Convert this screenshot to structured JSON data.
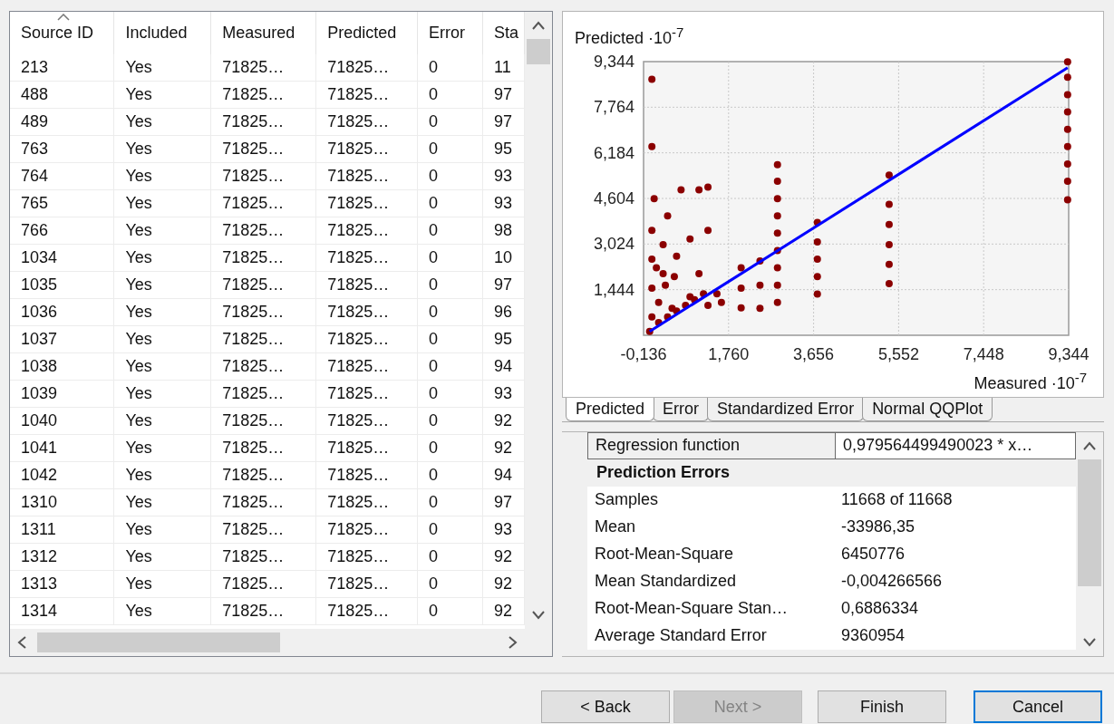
{
  "table": {
    "columns": [
      {
        "label": "Source ID",
        "sorted": true
      },
      {
        "label": "Included",
        "sorted": false
      },
      {
        "label": "Measured",
        "sorted": false
      },
      {
        "label": "Predicted",
        "sorted": false
      },
      {
        "label": "Error",
        "sorted": false
      },
      {
        "label": "Sta",
        "sorted": false
      }
    ],
    "rows": [
      [
        "213",
        "Yes",
        "71825…",
        "71825…",
        "0",
        "11"
      ],
      [
        "488",
        "Yes",
        "71825…",
        "71825…",
        "0",
        "97"
      ],
      [
        "489",
        "Yes",
        "71825…",
        "71825…",
        "0",
        "97"
      ],
      [
        "763",
        "Yes",
        "71825…",
        "71825…",
        "0",
        "95"
      ],
      [
        "764",
        "Yes",
        "71825…",
        "71825…",
        "0",
        "93"
      ],
      [
        "765",
        "Yes",
        "71825…",
        "71825…",
        "0",
        "93"
      ],
      [
        "766",
        "Yes",
        "71825…",
        "71825…",
        "0",
        "98"
      ],
      [
        "1034",
        "Yes",
        "71825…",
        "71825…",
        "0",
        "10"
      ],
      [
        "1035",
        "Yes",
        "71825…",
        "71825…",
        "0",
        "97"
      ],
      [
        "1036",
        "Yes",
        "71825…",
        "71825…",
        "0",
        "96"
      ],
      [
        "1037",
        "Yes",
        "71825…",
        "71825…",
        "0",
        "95"
      ],
      [
        "1038",
        "Yes",
        "71825…",
        "71825…",
        "0",
        "94"
      ],
      [
        "1039",
        "Yes",
        "71825…",
        "71825…",
        "0",
        "93"
      ],
      [
        "1040",
        "Yes",
        "71825…",
        "71825…",
        "0",
        "92"
      ],
      [
        "1041",
        "Yes",
        "71825…",
        "71825…",
        "0",
        "92"
      ],
      [
        "1042",
        "Yes",
        "71825…",
        "71825…",
        "0",
        "94"
      ],
      [
        "1310",
        "Yes",
        "71825…",
        "71825…",
        "0",
        "97"
      ],
      [
        "1311",
        "Yes",
        "71825…",
        "71825…",
        "0",
        "93"
      ],
      [
        "1312",
        "Yes",
        "71825…",
        "71825…",
        "0",
        "92"
      ],
      [
        "1313",
        "Yes",
        "71825…",
        "71825…",
        "0",
        "92"
      ],
      [
        "1314",
        "Yes",
        "71825…",
        "71825…",
        "0",
        "92"
      ]
    ]
  },
  "chart": {
    "chart_data": {
      "type": "scatter",
      "ylabel": "Predicted ·10$^{-7}$",
      "xlabel": "Measured ·10$^{-7}$",
      "grid": true,
      "xlim": [
        -0.136,
        9.344
      ],
      "ylim": [
        -0.136,
        9.344
      ],
      "xticks": [
        {
          "value": -0.136,
          "label": "-0,136"
        },
        {
          "value": 1.76,
          "label": "1,760"
        },
        {
          "value": 3.656,
          "label": "3,656"
        },
        {
          "value": 5.552,
          "label": "5,552"
        },
        {
          "value": 7.448,
          "label": "7,448"
        },
        {
          "value": 9.344,
          "label": "9,344"
        }
      ],
      "yticks": [
        {
          "value": 1.444,
          "label": "1,444"
        },
        {
          "value": 3.024,
          "label": "3,024"
        },
        {
          "value": 4.604,
          "label": "4,604"
        },
        {
          "value": 6.184,
          "label": "6,184"
        },
        {
          "value": 7.764,
          "label": "7,764"
        },
        {
          "value": 9.344,
          "label": "9,344"
        }
      ],
      "x": [
        0,
        0.05,
        0.05,
        0.05,
        0.05,
        0.1,
        0.05,
        0.05,
        0.2,
        0.3,
        0.3,
        0.4,
        0.5,
        0.6,
        0.7,
        0.9,
        0.9,
        1.1,
        1.1,
        1.3,
        1.3,
        1.3,
        1.5,
        1.6,
        0.2,
        0.4,
        0.6,
        0.8,
        1.0,
        1.2,
        0.15,
        0.35,
        0.55,
        2.04,
        2.04,
        2.04,
        2.46,
        2.46,
        2.46,
        2.85,
        2.85,
        2.85,
        2.85,
        2.85,
        2.85,
        2.85,
        2.85,
        2.85,
        3.74,
        3.74,
        3.74,
        3.74,
        3.74,
        5.34,
        5.34,
        5.34,
        5.34,
        5.34,
        5.34,
        9.32,
        9.32,
        9.32,
        9.32,
        9.32,
        9.32,
        9.32,
        9.32,
        9.32
      ],
      "series": [
        {
          "color": "#8b0000",
          "values": [
            0,
            0.5,
            1.5,
            2.5,
            3.5,
            4.6,
            8.73,
            6.4,
            1.0,
            2.0,
            3.0,
            4.0,
            0.8,
            2.6,
            4.9,
            3.2,
            1.2,
            4.9,
            2.0,
            5.0,
            3.5,
            0.9,
            1.3,
            1.0,
            0.3,
            0.5,
            0.7,
            0.9,
            1.1,
            1.3,
            2.2,
            1.6,
            1.9,
            0.81,
            1.5,
            2.2,
            0.8,
            1.6,
            2.44,
            1.0,
            1.6,
            2.2,
            2.8,
            3.4,
            4.0,
            4.6,
            5.2,
            5.77,
            1.29,
            1.9,
            2.5,
            3.1,
            3.77,
            1.65,
            2.32,
            3.0,
            3.7,
            4.4,
            5.41,
            4.56,
            5.2,
            5.8,
            6.4,
            7.0,
            7.6,
            8.2,
            8.8,
            9.34
          ]
        },
        {
          "type": "line",
          "color": "#0000ff",
          "values": [
            0,
            null,
            null,
            null,
            null,
            null,
            null,
            null,
            null,
            null,
            null,
            null,
            null,
            null,
            null,
            null,
            null,
            null,
            null,
            null,
            null,
            null,
            null,
            null,
            null,
            null,
            null,
            null,
            null,
            null,
            null,
            null,
            null,
            null,
            null,
            null,
            null,
            null,
            null,
            null,
            null,
            null,
            null,
            null,
            null,
            null,
            null,
            null,
            null,
            null,
            null,
            null,
            null,
            null,
            null,
            null,
            null,
            null,
            null,
            null,
            null,
            null,
            null,
            null,
            null,
            null,
            null,
            9.13
          ]
        }
      ]
    }
  },
  "tabs": [
    {
      "label": "Predicted",
      "selected": true
    },
    {
      "label": "Error",
      "selected": false
    },
    {
      "label": "Standardized Error",
      "selected": false
    },
    {
      "label": "Normal QQPlot",
      "selected": false
    }
  ],
  "properties": [
    {
      "kind": "property",
      "name": "Regression function",
      "value": "0,979564499490023 * x…",
      "selected": true
    },
    {
      "kind": "category",
      "name": "Prediction Errors"
    },
    {
      "kind": "property",
      "name": "Samples",
      "value": "11668 of 11668",
      "selected": false
    },
    {
      "kind": "property",
      "name": "Mean",
      "value": "-33986,35",
      "selected": false
    },
    {
      "kind": "property",
      "name": "Root-Mean-Square",
      "value": "6450776",
      "selected": false
    },
    {
      "kind": "property",
      "name": "Mean Standardized",
      "value": "-0,004266566",
      "selected": false
    },
    {
      "kind": "property",
      "name": "Root-Mean-Square Stan…",
      "value": "0,6886334",
      "selected": false
    },
    {
      "kind": "property",
      "name": "Average Standard Error",
      "value": "9360954",
      "selected": false
    }
  ],
  "buttons": [
    {
      "label": "< Back",
      "disabled": false,
      "default": false
    },
    {
      "label": "Next >",
      "disabled": true,
      "default": false
    },
    {
      "label": "Finish",
      "disabled": false,
      "default": false
    },
    {
      "label": "Cancel",
      "disabled": false,
      "default": true
    }
  ]
}
